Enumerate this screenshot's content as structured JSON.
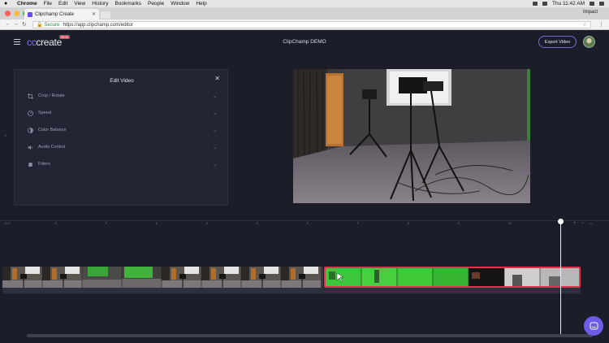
{
  "menubar": {
    "app": "Chrome",
    "items": [
      "File",
      "Edit",
      "View",
      "History",
      "Bookmarks",
      "People",
      "Window",
      "Help"
    ],
    "clock": "Thu 11:42 AM"
  },
  "browser": {
    "tab_title": "Clipchamp Create",
    "profile": "Impact",
    "secure_label": "Secure",
    "url": "https://app.clipchamp.com/editor"
  },
  "app": {
    "logo_prefix": "cc",
    "logo_text": "create",
    "beta": "BETA",
    "project_title": "ClipChamp DEMO",
    "export_label": "Export Video"
  },
  "edit_panel": {
    "title": "Edit Video",
    "items": [
      {
        "label": "Crop / Rotate",
        "icon": "crop-icon"
      },
      {
        "label": "Speed",
        "icon": "speed-icon"
      },
      {
        "label": "Color Balance",
        "icon": "color-balance-icon"
      },
      {
        "label": "Audio Control",
        "icon": "audio-icon"
      },
      {
        "label": "Filters",
        "icon": "filters-icon"
      }
    ]
  },
  "timeline": {
    "ticks": [
      "0:00",
      "1",
      "2",
      "3",
      "4",
      "5",
      "6",
      "7",
      "8",
      "9",
      "10"
    ],
    "playhead_position": 0.92
  },
  "colors": {
    "accent": "#7d6cff",
    "selected_clip": "#e0344d",
    "background": "#1b1e29"
  }
}
